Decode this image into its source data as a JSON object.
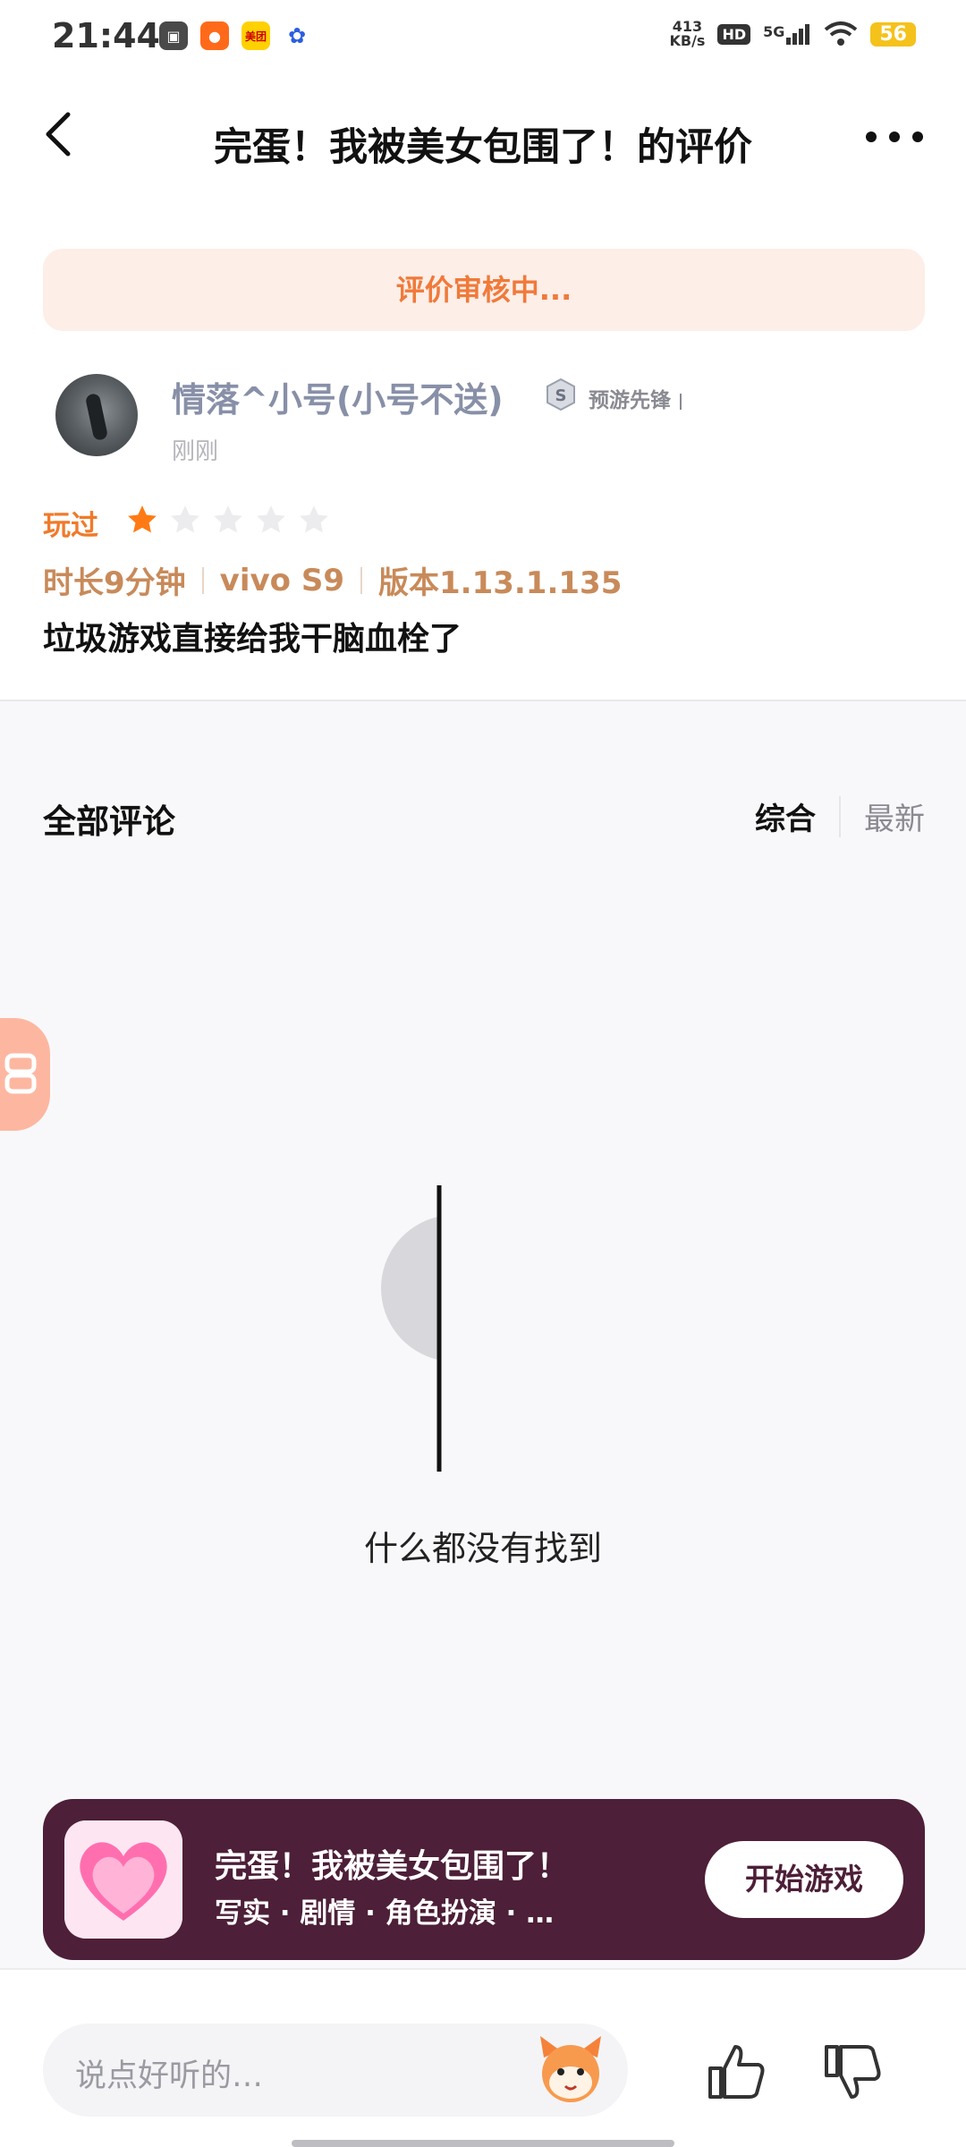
{
  "status_bar": {
    "time": "21:44",
    "net_speed_value": "413",
    "net_speed_unit": "KB/s",
    "hd": "HD",
    "signal": "5G",
    "battery": "56",
    "apps": [
      "chat-app-icon",
      "kuaishou-icon",
      "meituan-icon",
      "baidu-icon"
    ],
    "meituan_label": "美团"
  },
  "header": {
    "title": "完蛋！我被美女包围了！的评价"
  },
  "review": {
    "status_banner": "评价审核中...",
    "username": "情落^小号(小号不送)",
    "badge": "预游先锋",
    "time": "刚刚",
    "played_label": "玩过",
    "rating": 1,
    "rating_max": 5,
    "duration": "时长9分钟",
    "device": "vivo S9",
    "version": "版本1.13.1.135",
    "content": "垃圾游戏直接给我干脑血栓了"
  },
  "comments": {
    "title": "全部评论",
    "sort_options": [
      "综合",
      "最新"
    ],
    "active_sort": "综合",
    "empty_text": "什么都没有找到"
  },
  "game_card": {
    "name": "完蛋！我被美女包围了！",
    "tags": "写实 · 剧情 · 角色扮演 · …",
    "start_button": "开始游戏"
  },
  "bottom_bar": {
    "placeholder": "说点好听的…"
  },
  "colors": {
    "accent": "#f07a2a",
    "banner_bg": "#fdeee8",
    "card_bg": "#4d1f38",
    "username": "#8890a8"
  }
}
